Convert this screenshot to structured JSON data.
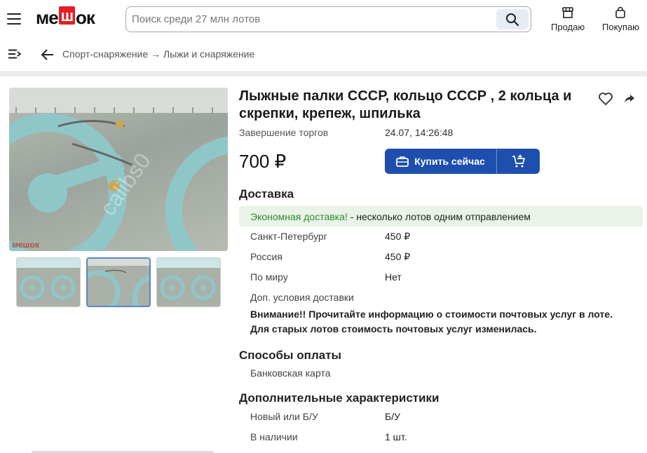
{
  "header": {
    "logo_prefix": "ме",
    "logo_highlight": "ш",
    "logo_suffix": "ок",
    "search_placeholder": "Поиск среди 27 млн лотов",
    "sell_label": "Продаю",
    "buy_label": "Покупаю"
  },
  "breadcrumb": {
    "text": "Спорт-снаряжение → Лыжи и снаряжение"
  },
  "lot": {
    "title": "Лыжные палки СССР, кольцо СССР , 2 кольца и скрепки, крепеж, шпилька",
    "end_label": "Завершение торгов",
    "end_value": "24.07, 14:26:48",
    "price": "700 ₽",
    "buy_now_label": "Купить сейчас",
    "watermark": "calibs0",
    "image_logo": "мешок"
  },
  "delivery": {
    "heading": "Доставка",
    "eco_highlight": "Экономная доставка!",
    "eco_rest": " - несколько лотов одним отправлением",
    "rows": [
      {
        "label": "Санкт-Петербург",
        "value": "450 ₽"
      },
      {
        "label": "Россия",
        "value": "450 ₽"
      },
      {
        "label": "По миру",
        "value": "Нет"
      }
    ],
    "extra_label": "Доп. условия доставки",
    "notice": "Внимание!! Прочитайте информацию о стоимости почтовых услуг в лоте. Для старых лотов стоимость почтовых услуг изменилась."
  },
  "payment": {
    "heading": "Способы оплаты",
    "method": "Банковская карта"
  },
  "characteristics": {
    "heading": "Дополнительные характеристики",
    "rows": [
      {
        "label": "Новый или Б/У",
        "value": "Б/У"
      },
      {
        "label": "В наличии",
        "value": "1 шт."
      }
    ]
  },
  "colors": {
    "accent": "#1e4fae",
    "logo_red": "#e31e24",
    "eco_bg": "#e9f3e7",
    "eco_green": "#2e8b2e",
    "wheel": "#8fc7c9"
  },
  "icons": [
    "menu-icon",
    "search-icon",
    "shop-icon",
    "bag-icon",
    "list-menu-icon",
    "arrow-left-icon",
    "heart-icon",
    "share-icon",
    "briefcase-icon",
    "cart-plus-icon"
  ]
}
